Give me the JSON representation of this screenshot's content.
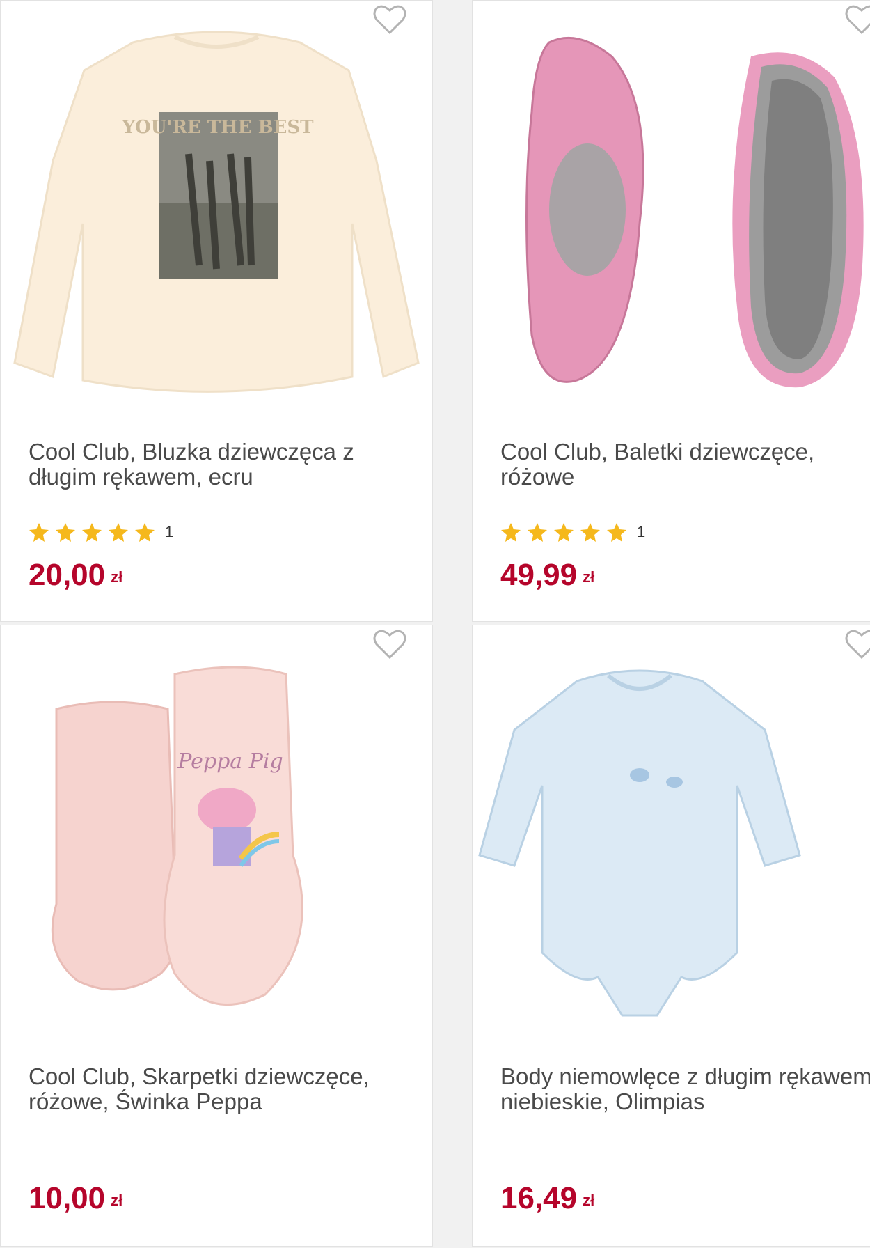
{
  "products": [
    {
      "title": "Cool Club, Bluzka dziewczęca z długim rękawem, ecru",
      "rating_stars": 5,
      "rating_count": "1",
      "price": "20,00",
      "currency": "zł",
      "image_icon": "long-sleeve-top-photo",
      "print_text": "YOU'RE THE BEST"
    },
    {
      "title": "Cool Club, Baletki dziewczęce, różowe",
      "rating_stars": 5,
      "rating_count": "1",
      "price": "49,99",
      "currency": "zł",
      "image_icon": "ballet-shoes-photo"
    },
    {
      "title": "Cool Club, Skarpetki dziewczęce, różowe, Świnka Peppa",
      "price": "10,00",
      "currency": "zł",
      "image_icon": "socks-photo",
      "print_text": "Peppa Pig"
    },
    {
      "title": "Body niemowlęce z długim rękawem, niebieskie, Olimpias",
      "price": "16,49",
      "currency": "zł",
      "image_icon": "baby-bodysuit-photo"
    }
  ],
  "colors": {
    "price": "#b5052b",
    "star": "#f5b81c",
    "title": "#4a4a4a",
    "card_border": "#e2e2e2",
    "page_bg": "#f1f1f1"
  },
  "wishlist_icon": "heart-outline-icon"
}
